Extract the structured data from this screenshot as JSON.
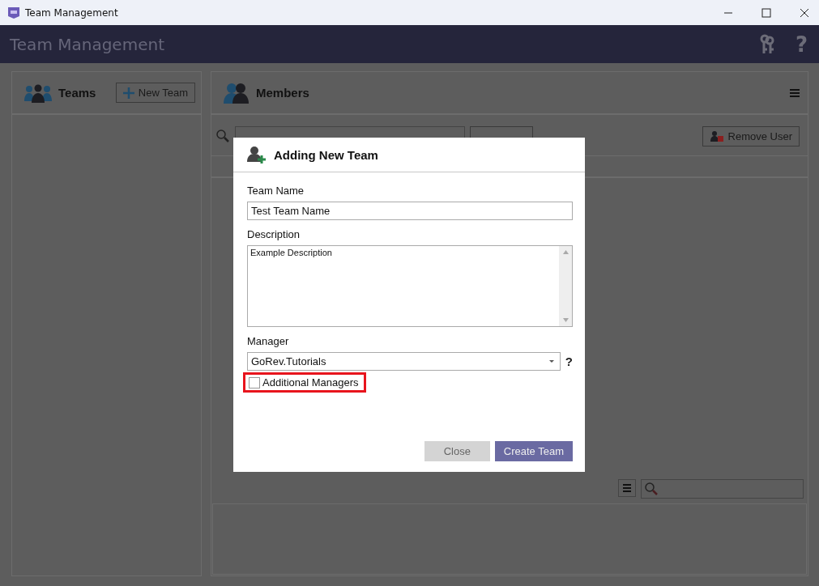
{
  "window": {
    "title": "Team Management"
  },
  "header": {
    "title": "Team Management",
    "help": "?"
  },
  "teams_panel": {
    "title": "Teams",
    "new_button": "New Team"
  },
  "members_panel": {
    "title": "Members",
    "remove_button": "Remove User"
  },
  "dialog": {
    "title": "Adding New Team",
    "team_name": {
      "label": "Team Name",
      "value": "Test Team Name"
    },
    "description": {
      "label": "Description",
      "value": "Example Description"
    },
    "manager": {
      "label": "Manager",
      "value": "GoRev.Tutorials",
      "help": "?"
    },
    "additional_managers": {
      "label": "Additional Managers",
      "checked": false,
      "highlighted": true
    },
    "buttons": [
      {
        "label": "Close",
        "kind": "secondary"
      },
      {
        "label": "Create Team",
        "kind": "primary"
      }
    ]
  }
}
